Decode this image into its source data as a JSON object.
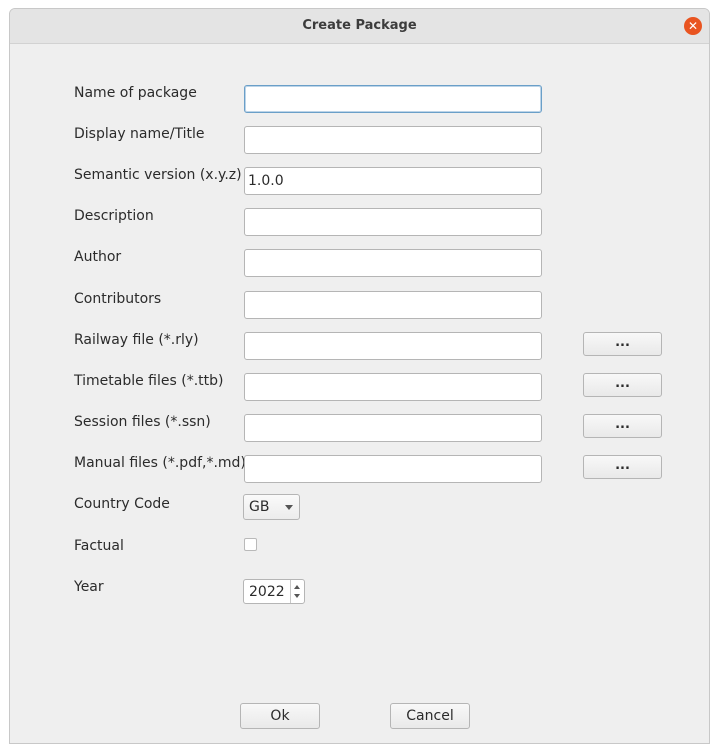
{
  "window": {
    "title": "Create Package"
  },
  "form": {
    "fields": [
      {
        "label": "Name of package",
        "value": ""
      },
      {
        "label": "Display name/Title",
        "value": ""
      },
      {
        "label": "Semantic version (x.y.z)",
        "value": "1.0.0"
      },
      {
        "label": "Description",
        "value": ""
      },
      {
        "label": "Author",
        "value": ""
      },
      {
        "label": "Contributors",
        "value": ""
      },
      {
        "label": "Railway file (*.rly)",
        "value": ""
      },
      {
        "label": "Timetable files (*.ttb)",
        "value": ""
      },
      {
        "label": "Session files (*.ssn)",
        "value": ""
      },
      {
        "label": "Manual files (*.pdf,*.md)",
        "value": ""
      }
    ],
    "browse_label": "...",
    "country_code": {
      "label": "Country Code",
      "value": "GB"
    },
    "factual": {
      "label": "Factual",
      "checked": false
    },
    "year": {
      "label": "Year",
      "value": "2022"
    }
  },
  "buttons": {
    "ok": "Ok",
    "cancel": "Cancel"
  },
  "colors": {
    "close_button": "#e95420",
    "focus_border": "#6a9fc8",
    "background": "#efefef"
  }
}
